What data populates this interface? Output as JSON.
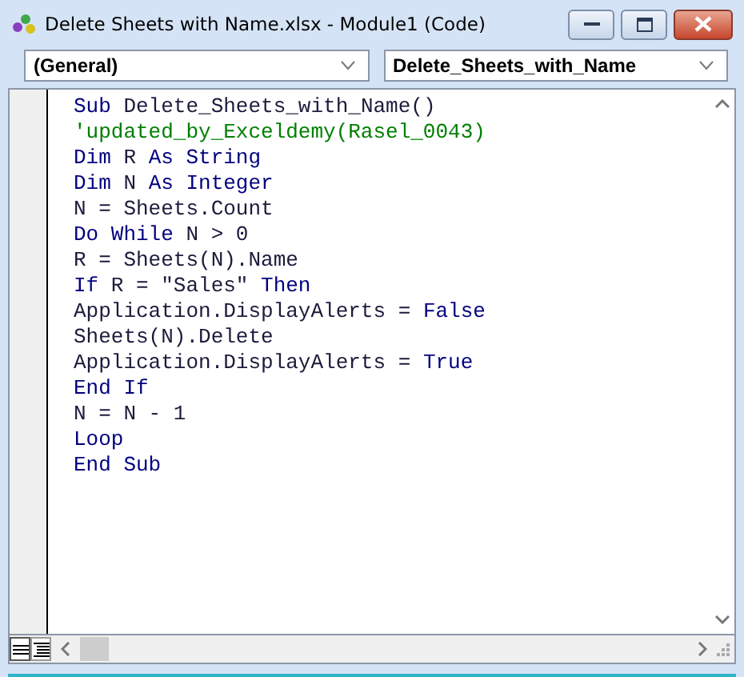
{
  "window": {
    "title": "Delete Sheets with Name.xlsx - Module1 (Code)"
  },
  "object_dropdown": {
    "value": "(General)"
  },
  "procedure_dropdown": {
    "value": "Delete_Sheets_with_Name"
  },
  "code_lines": [
    [
      {
        "text": "Sub ",
        "kind": "keyword"
      },
      {
        "text": "Delete_Sheets_with_Name()",
        "kind": "plain"
      }
    ],
    [
      {
        "text": "'updated_by_Exceldemy(Rasel_0043)",
        "kind": "comment"
      }
    ],
    [
      {
        "text": "Dim ",
        "kind": "keyword"
      },
      {
        "text": "R ",
        "kind": "plain"
      },
      {
        "text": "As String",
        "kind": "keyword"
      }
    ],
    [
      {
        "text": "Dim ",
        "kind": "keyword"
      },
      {
        "text": "N ",
        "kind": "plain"
      },
      {
        "text": "As Integer",
        "kind": "keyword"
      }
    ],
    [
      {
        "text": "N = Sheets.Count",
        "kind": "plain"
      }
    ],
    [
      {
        "text": "Do While ",
        "kind": "keyword"
      },
      {
        "text": "N > 0",
        "kind": "plain"
      }
    ],
    [
      {
        "text": "R = Sheets(N).Name",
        "kind": "plain"
      }
    ],
    [
      {
        "text": "If ",
        "kind": "keyword"
      },
      {
        "text": "R = \"Sales\" ",
        "kind": "plain"
      },
      {
        "text": "Then",
        "kind": "keyword"
      }
    ],
    [
      {
        "text": "Application.DisplayAlerts = ",
        "kind": "plain"
      },
      {
        "text": "False",
        "kind": "keyword"
      }
    ],
    [
      {
        "text": "Sheets(N).Delete",
        "kind": "plain"
      }
    ],
    [
      {
        "text": "Application.DisplayAlerts = ",
        "kind": "plain"
      },
      {
        "text": "True",
        "kind": "keyword"
      }
    ],
    [
      {
        "text": "End If",
        "kind": "keyword"
      }
    ],
    [
      {
        "text": "N = N - 1",
        "kind": "plain"
      }
    ],
    [
      {
        "text": "Loop",
        "kind": "keyword"
      }
    ],
    [
      {
        "text": "End Sub",
        "kind": "keyword"
      }
    ]
  ]
}
